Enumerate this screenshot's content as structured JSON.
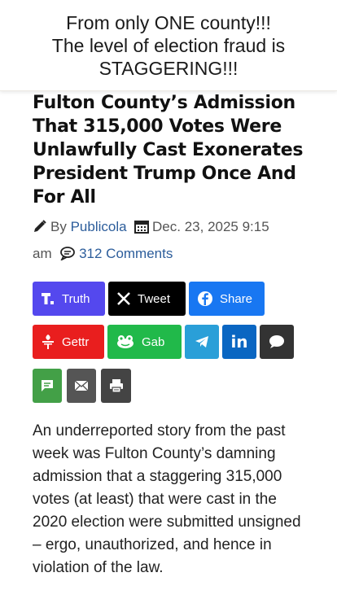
{
  "caption": {
    "lines": [
      "From only ONE county!!!",
      "The level of election fraud is",
      "STAGGERING!!!"
    ]
  },
  "article": {
    "title": "Fulton County’s Admission That 315,000 Votes Were Unlawfully Cast Exonerates President Trump Once And For All",
    "by_prefix": "By",
    "author": "Publicola",
    "date": "Dec. 23, 2025 9:15",
    "time_suffix": "am",
    "comments": "312 Comments",
    "body": "An underreported story from the past week was Fulton County’s damning admission that a staggering 315,000 votes (at least) that were cast in the 2020 election were submitted unsigned – ergo, unauthorized, and hence in violation of the law."
  },
  "share": {
    "truth": "Truth",
    "tweet": "Tweet",
    "share": "Share",
    "gettr": "Gettr",
    "gab": "Gab",
    "linkedin": "in"
  },
  "colors": {
    "truth": "#5448ee",
    "tweet": "#000000",
    "facebook": "#1877f2",
    "gettr": "#e91e1e",
    "gab": "#21b94a",
    "telegram": "#2a9fd8",
    "linkedin": "#0a66c2",
    "sms": "#333333",
    "message": "#43a047",
    "email": "#555555",
    "print": "#444444",
    "link": "#2c5d9b"
  }
}
